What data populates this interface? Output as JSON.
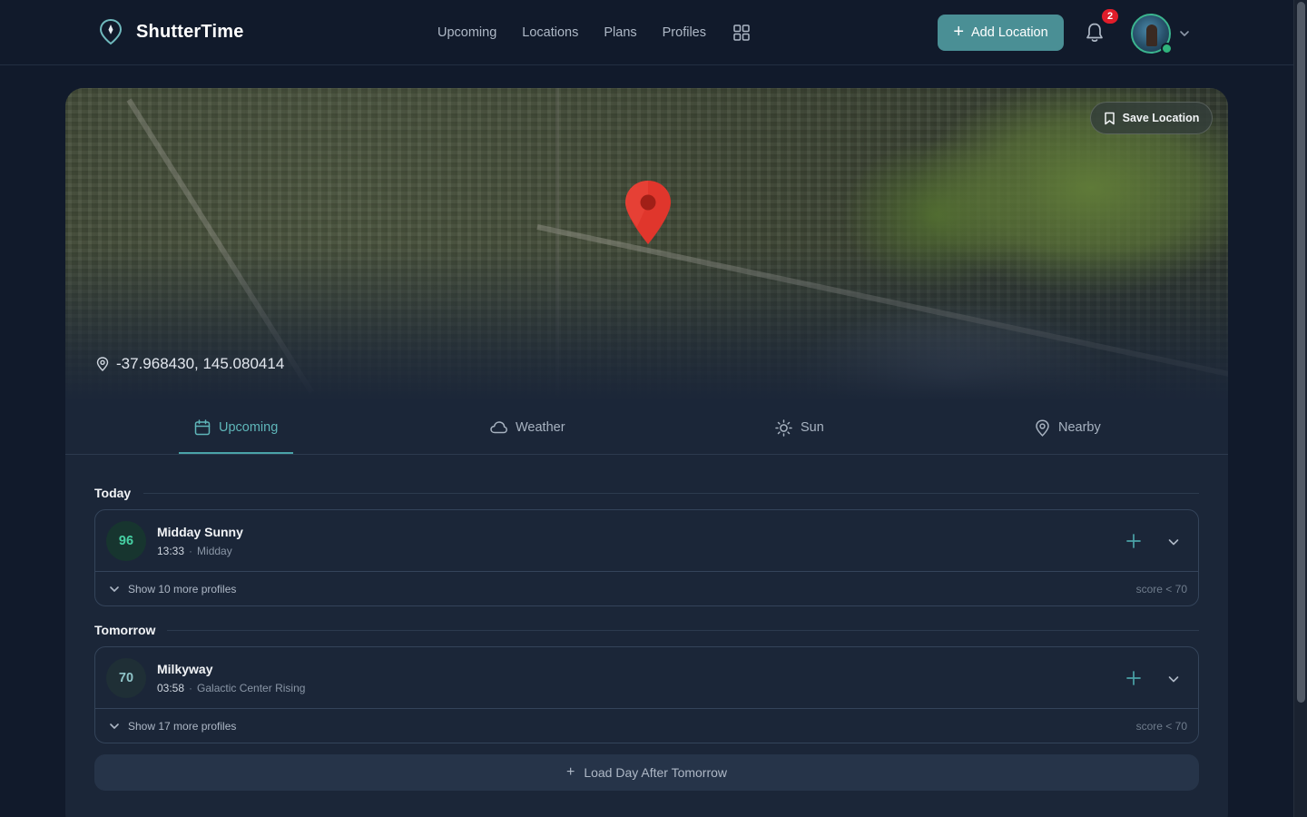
{
  "app": {
    "name": "ShutterTime",
    "notification_count": "2"
  },
  "nav": {
    "links": [
      "Upcoming",
      "Locations",
      "Plans",
      "Profiles"
    ],
    "add_location": "Add Location"
  },
  "location": {
    "coordinates": "-37.968430, 145.080414",
    "save_label": "Save Location"
  },
  "tabs": [
    {
      "label": "Upcoming",
      "icon": "calendar-icon",
      "active": true
    },
    {
      "label": "Weather",
      "icon": "cloud-icon",
      "active": false
    },
    {
      "label": "Sun",
      "icon": "sun-icon",
      "active": false
    },
    {
      "label": "Nearby",
      "icon": "map-pin-icon",
      "active": false
    }
  ],
  "days": [
    {
      "title": "Today",
      "event": {
        "score": "96",
        "name": "Midday Sunny",
        "time": "13:33",
        "subtitle": "Midday"
      },
      "more_label": "Show 10 more profiles",
      "threshold": "score < 70"
    },
    {
      "title": "Tomorrow",
      "event": {
        "score": "70",
        "name": "Milkyway",
        "time": "03:58",
        "subtitle": "Galactic Center Rising"
      },
      "more_label": "Show 17 more profiles",
      "threshold": "score < 70"
    }
  ],
  "load_more": "Load Day After Tomorrow",
  "colors": {
    "accent": "#4a8f95",
    "background": "#111a2b",
    "card": "#1b2638",
    "high_score": "#46d0a3",
    "badge": "#e11d2a",
    "pin": "#e0362c"
  }
}
